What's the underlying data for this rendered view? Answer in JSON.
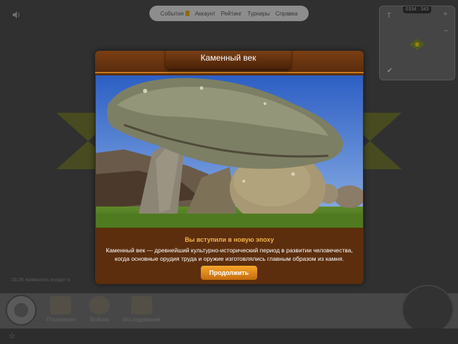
{
  "topnav": {
    "items": [
      "События",
      "Аккаунт",
      "Рейтинг",
      "Турниры",
      "Справка"
    ]
  },
  "minimap": {
    "coords": "0334 : 343"
  },
  "chat": {
    "line": "18:38 появилось входит в"
  },
  "bottom_bar": {
    "items": [
      "Поселения",
      "Войска",
      "Исследования"
    ]
  },
  "dialog": {
    "title": "Каменный век",
    "heading": "Вы вступили в новую эпоху",
    "description": "Каменный век — древнейший культурно-исторический период в развитии человечества, когда основные орудия труда и оружие изготовлялись главным образом из камня.",
    "continue_label": "Продолжить",
    "photo_subject": "dolmen"
  },
  "colors": {
    "dialog_bg": "#5c2e0d",
    "accent": "#f3b34b",
    "button": "#e58a1b"
  }
}
